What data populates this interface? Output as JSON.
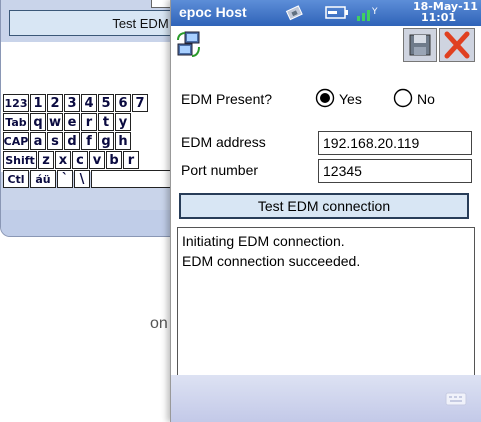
{
  "back_window": {
    "test_button_label": "Test EDM co",
    "keyboard_rows": [
      [
        "123",
        "1",
        "2",
        "3",
        "4",
        "5",
        "6",
        "7"
      ],
      [
        "Tab",
        "q",
        "w",
        "e",
        "r",
        "t",
        "y"
      ],
      [
        "CAP",
        "a",
        "s",
        "d",
        "f",
        "g",
        "h"
      ],
      [
        "Shift",
        "z",
        "x",
        "c",
        "v",
        "b",
        "r"
      ],
      [
        "Ctl",
        "áü",
        "`",
        "\\",
        ""
      ]
    ]
  },
  "caption_fragment": "on to confirm a",
  "titlebar": {
    "app_title": "epoc Host",
    "date": "18-May-11",
    "time": "11:01"
  },
  "form": {
    "edm_present_label": "EDM Present?",
    "yes_label": "Yes",
    "no_label": "No",
    "selected": "Yes",
    "edm_address_label": "EDM address",
    "edm_address_value": "192.168.20.119",
    "port_label": "Port number",
    "port_value": "12345",
    "test_button_label": "Test EDM connection"
  },
  "log_lines": [
    "Initiating EDM connection.",
    "EDM connection succeeded."
  ],
  "icons": {
    "app_icon": "sync-computers-icon",
    "save_icon": "floppy-disk-icon",
    "close_icon": "red-x-icon",
    "keyboard_icon": "keyboard-icon"
  },
  "colors": {
    "titlebar": "#2f63b8",
    "button": "#d8e6f4",
    "close": "#e04020"
  }
}
